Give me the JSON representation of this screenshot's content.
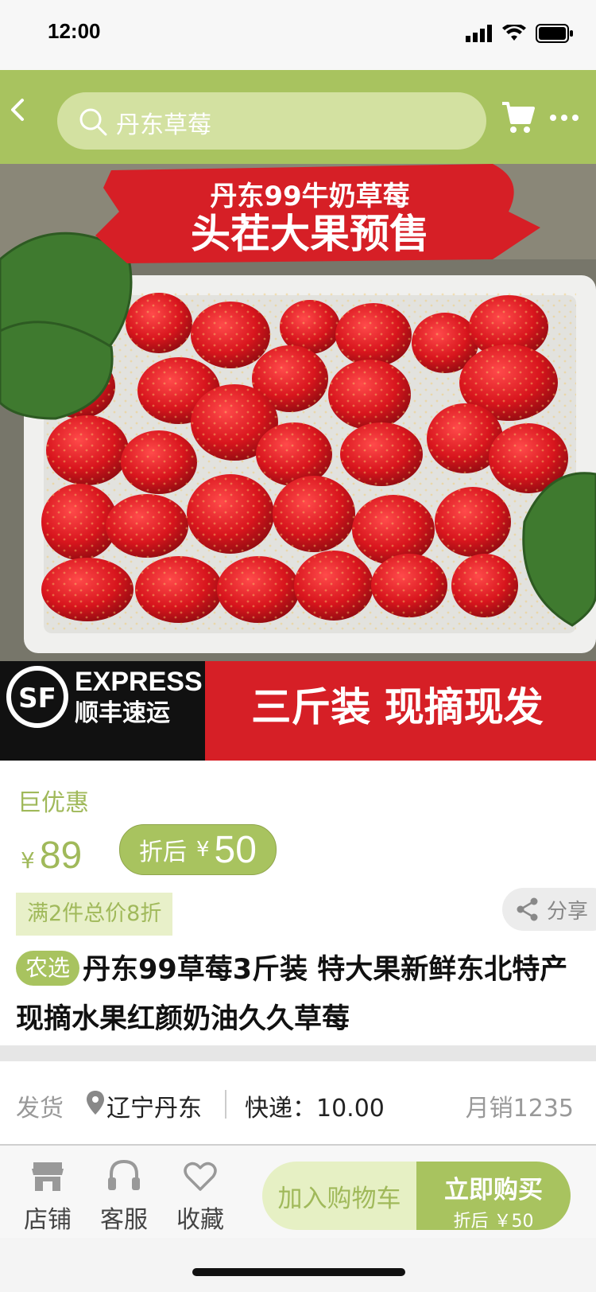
{
  "status_bar": {
    "time": "12:00"
  },
  "nav": {
    "search_placeholder": "丹东草莓"
  },
  "hero": {
    "banner_line1": "丹东99牛奶草莓",
    "banner_line2": "头茬大果预售",
    "logo_sf": "SF",
    "logo_express": "EXPRESS",
    "logo_cn": "顺丰速运",
    "footer_text": "三斤装 现摘现发"
  },
  "product": {
    "promo_label": "巨优惠",
    "currency": "¥",
    "price": "89",
    "after_label": "折后",
    "after_price": "50",
    "coupon": "满2件总价8折",
    "share_label": "分享",
    "tag": "农选",
    "title": "丹东99草莓3斤装 特大果新鲜东北特产现摘水果红颜奶油久久草莓"
  },
  "shipping": {
    "label": "发货",
    "location": "辽宁丹东",
    "express": "快递：10.00",
    "monthly_sales": "月销1235"
  },
  "bottom_bar": {
    "shop": "店铺",
    "service": "客服",
    "favorite": "收藏",
    "add_cart": "加入购物车",
    "buy_now": "立即购买",
    "buy_price": "折后 ￥50"
  },
  "colors": {
    "accent": "#a8c35f",
    "accent_light": "#e6f0c4",
    "banner_red": "#d61f26"
  }
}
